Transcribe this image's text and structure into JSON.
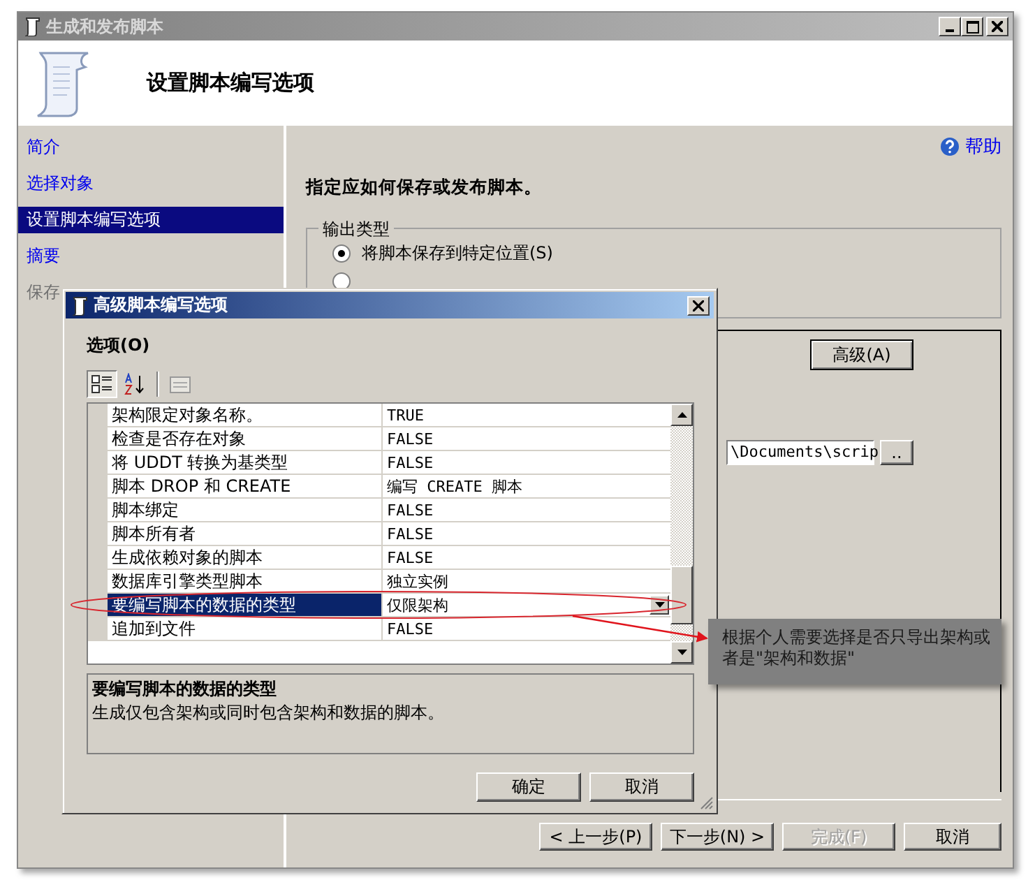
{
  "window": {
    "title": "生成和发布脚本",
    "header": "设置脚本编写选项"
  },
  "nav": [
    {
      "label": "简介",
      "selected": false,
      "disabled": false
    },
    {
      "label": "选择对象",
      "selected": false,
      "disabled": false
    },
    {
      "label": "设置脚本编写选项",
      "selected": true,
      "disabled": false
    },
    {
      "label": "摘要",
      "selected": false,
      "disabled": false
    },
    {
      "label": "保存",
      "selected": false,
      "disabled": true
    }
  ],
  "help": "帮助",
  "instruction": "指定应如何保存或发布脚本。",
  "output_type": {
    "legend": "输出类型",
    "options": [
      {
        "label": "将脚本保存到特定位置(S)",
        "selected": true
      },
      {
        "selected": false
      }
    ]
  },
  "advanced_button": "高级(A)",
  "file_path": {
    "value": "\\Documents\\scrip",
    "browse": ".."
  },
  "buttons": [
    {
      "label": "< 上一步(P)",
      "disabled": false
    },
    {
      "label": "下一步(N) >",
      "disabled": false
    },
    {
      "label": "完成(F)",
      "disabled": true
    },
    {
      "label": "取消",
      "disabled": false
    }
  ],
  "dialog": {
    "title": "高级脚本编写选项",
    "section": "选项(O)",
    "properties": [
      {
        "name": "架构限定对象名称。",
        "value": "TRUE",
        "selected": false
      },
      {
        "name": "检查是否存在对象",
        "value": "FALSE",
        "selected": false
      },
      {
        "name": "将 UDDT 转换为基类型",
        "value": "FALSE",
        "selected": false
      },
      {
        "name": "脚本 DROP 和 CREATE",
        "value": "编写 CREATE 脚本",
        "selected": false
      },
      {
        "name": "脚本绑定",
        "value": "FALSE",
        "selected": false
      },
      {
        "name": "脚本所有者",
        "value": "FALSE",
        "selected": false
      },
      {
        "name": "生成依赖对象的脚本",
        "value": "FALSE",
        "selected": false
      },
      {
        "name": "数据库引擎类型脚本",
        "value": "独立实例",
        "selected": false
      },
      {
        "name": "要编写脚本的数据的类型",
        "value": "仅限架构",
        "selected": true
      },
      {
        "name": "追加到文件",
        "value": "FALSE",
        "selected": false
      }
    ],
    "description_title": "要编写脚本的数据的类型",
    "description": "生成仅包含架构或同时包含架构和数据的脚本。",
    "buttons": [
      "确定",
      "取消"
    ]
  },
  "annotation": "根据个人需要选择是否只导出架构或者是\"架构和数据\""
}
